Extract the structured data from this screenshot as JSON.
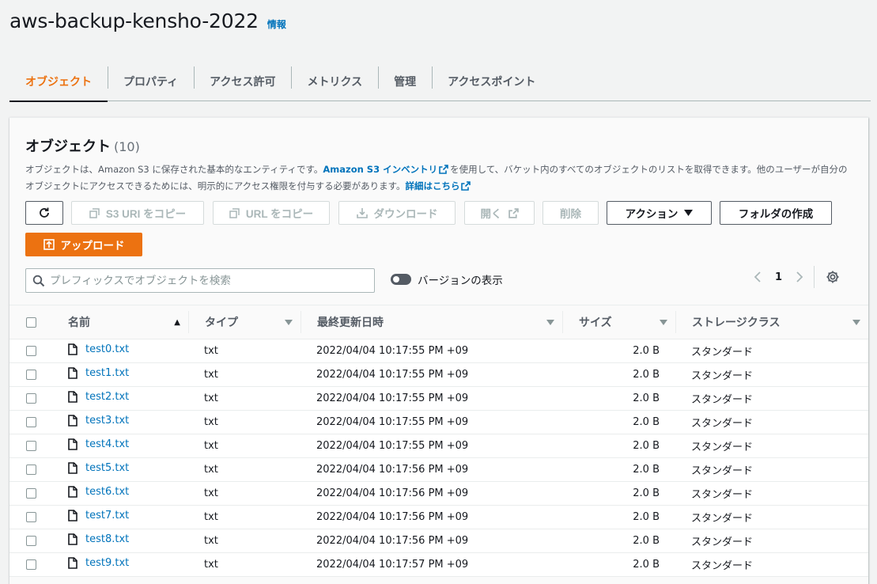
{
  "header": {
    "title": "aws-backup-kensho-2022",
    "info_link": "情報"
  },
  "tabs": [
    {
      "label": "オブジェクト",
      "active": true
    },
    {
      "label": "プロパティ",
      "active": false
    },
    {
      "label": "アクセス許可",
      "active": false
    },
    {
      "label": "メトリクス",
      "active": false
    },
    {
      "label": "管理",
      "active": false
    },
    {
      "label": "アクセスポイント",
      "active": false
    }
  ],
  "panel": {
    "title": "オブジェクト",
    "count": "(10)",
    "desc_part1": "オブジェクトは、Amazon S3 に保存された基本的なエンティティです。",
    "desc_link1": "Amazon S3 インベントリ",
    "desc_part2": "を使用して、バケット内のすべてのオブジェクトのリストを取得できます。他のユーザーが自分のオブジェクトにアクセスできるためには、明示的にアクセス権限を付与する必要があります。",
    "desc_link2": "詳細はこちら"
  },
  "toolbar": {
    "copy_s3_uri": "S3 URI をコピー",
    "copy_url": "URL をコピー",
    "download": "ダウンロード",
    "open": "開く",
    "delete": "削除",
    "actions": "アクション",
    "create_folder": "フォルダの作成",
    "upload": "アップロード"
  },
  "search": {
    "placeholder": "プレフィックスでオブジェクトを検索"
  },
  "versions_toggle": {
    "label": "バージョンの表示",
    "on": false
  },
  "pagination": {
    "page": "1"
  },
  "table": {
    "columns": [
      "名前",
      "タイプ",
      "最終更新日時",
      "サイズ",
      "ストレージクラス"
    ],
    "rows": [
      {
        "name": "test0.txt",
        "type": "txt",
        "modified": "2022/04/04 10:17:55 PM +09",
        "size": "2.0 B",
        "storage": "スタンダード"
      },
      {
        "name": "test1.txt",
        "type": "txt",
        "modified": "2022/04/04 10:17:55 PM +09",
        "size": "2.0 B",
        "storage": "スタンダード"
      },
      {
        "name": "test2.txt",
        "type": "txt",
        "modified": "2022/04/04 10:17:55 PM +09",
        "size": "2.0 B",
        "storage": "スタンダード"
      },
      {
        "name": "test3.txt",
        "type": "txt",
        "modified": "2022/04/04 10:17:55 PM +09",
        "size": "2.0 B",
        "storage": "スタンダード"
      },
      {
        "name": "test4.txt",
        "type": "txt",
        "modified": "2022/04/04 10:17:55 PM +09",
        "size": "2.0 B",
        "storage": "スタンダード"
      },
      {
        "name": "test5.txt",
        "type": "txt",
        "modified": "2022/04/04 10:17:56 PM +09",
        "size": "2.0 B",
        "storage": "スタンダード"
      },
      {
        "name": "test6.txt",
        "type": "txt",
        "modified": "2022/04/04 10:17:56 PM +09",
        "size": "2.0 B",
        "storage": "スタンダード"
      },
      {
        "name": "test7.txt",
        "type": "txt",
        "modified": "2022/04/04 10:17:56 PM +09",
        "size": "2.0 B",
        "storage": "スタンダード"
      },
      {
        "name": "test8.txt",
        "type": "txt",
        "modified": "2022/04/04 10:17:56 PM +09",
        "size": "2.0 B",
        "storage": "スタンダード"
      },
      {
        "name": "test9.txt",
        "type": "txt",
        "modified": "2022/04/04 10:17:57 PM +09",
        "size": "2.0 B",
        "storage": "スタンダード"
      }
    ]
  },
  "colors": {
    "accent": "#ec7211",
    "link": "#0073bb",
    "text": "#16191f",
    "muted": "#545b64"
  }
}
